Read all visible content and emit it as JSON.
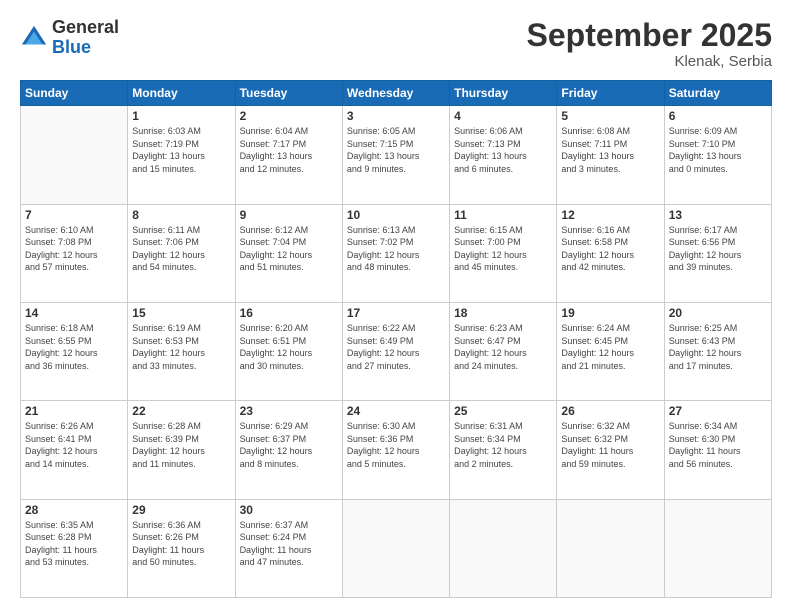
{
  "header": {
    "logo_general": "General",
    "logo_blue": "Blue",
    "month_title": "September 2025",
    "location": "Klenak, Serbia"
  },
  "days_of_week": [
    "Sunday",
    "Monday",
    "Tuesday",
    "Wednesday",
    "Thursday",
    "Friday",
    "Saturday"
  ],
  "weeks": [
    [
      {
        "day": "",
        "info": ""
      },
      {
        "day": "1",
        "info": "Sunrise: 6:03 AM\nSunset: 7:19 PM\nDaylight: 13 hours\nand 15 minutes."
      },
      {
        "day": "2",
        "info": "Sunrise: 6:04 AM\nSunset: 7:17 PM\nDaylight: 13 hours\nand 12 minutes."
      },
      {
        "day": "3",
        "info": "Sunrise: 6:05 AM\nSunset: 7:15 PM\nDaylight: 13 hours\nand 9 minutes."
      },
      {
        "day": "4",
        "info": "Sunrise: 6:06 AM\nSunset: 7:13 PM\nDaylight: 13 hours\nand 6 minutes."
      },
      {
        "day": "5",
        "info": "Sunrise: 6:08 AM\nSunset: 7:11 PM\nDaylight: 13 hours\nand 3 minutes."
      },
      {
        "day": "6",
        "info": "Sunrise: 6:09 AM\nSunset: 7:10 PM\nDaylight: 13 hours\nand 0 minutes."
      }
    ],
    [
      {
        "day": "7",
        "info": "Sunrise: 6:10 AM\nSunset: 7:08 PM\nDaylight: 12 hours\nand 57 minutes."
      },
      {
        "day": "8",
        "info": "Sunrise: 6:11 AM\nSunset: 7:06 PM\nDaylight: 12 hours\nand 54 minutes."
      },
      {
        "day": "9",
        "info": "Sunrise: 6:12 AM\nSunset: 7:04 PM\nDaylight: 12 hours\nand 51 minutes."
      },
      {
        "day": "10",
        "info": "Sunrise: 6:13 AM\nSunset: 7:02 PM\nDaylight: 12 hours\nand 48 minutes."
      },
      {
        "day": "11",
        "info": "Sunrise: 6:15 AM\nSunset: 7:00 PM\nDaylight: 12 hours\nand 45 minutes."
      },
      {
        "day": "12",
        "info": "Sunrise: 6:16 AM\nSunset: 6:58 PM\nDaylight: 12 hours\nand 42 minutes."
      },
      {
        "day": "13",
        "info": "Sunrise: 6:17 AM\nSunset: 6:56 PM\nDaylight: 12 hours\nand 39 minutes."
      }
    ],
    [
      {
        "day": "14",
        "info": "Sunrise: 6:18 AM\nSunset: 6:55 PM\nDaylight: 12 hours\nand 36 minutes."
      },
      {
        "day": "15",
        "info": "Sunrise: 6:19 AM\nSunset: 6:53 PM\nDaylight: 12 hours\nand 33 minutes."
      },
      {
        "day": "16",
        "info": "Sunrise: 6:20 AM\nSunset: 6:51 PM\nDaylight: 12 hours\nand 30 minutes."
      },
      {
        "day": "17",
        "info": "Sunrise: 6:22 AM\nSunset: 6:49 PM\nDaylight: 12 hours\nand 27 minutes."
      },
      {
        "day": "18",
        "info": "Sunrise: 6:23 AM\nSunset: 6:47 PM\nDaylight: 12 hours\nand 24 minutes."
      },
      {
        "day": "19",
        "info": "Sunrise: 6:24 AM\nSunset: 6:45 PM\nDaylight: 12 hours\nand 21 minutes."
      },
      {
        "day": "20",
        "info": "Sunrise: 6:25 AM\nSunset: 6:43 PM\nDaylight: 12 hours\nand 17 minutes."
      }
    ],
    [
      {
        "day": "21",
        "info": "Sunrise: 6:26 AM\nSunset: 6:41 PM\nDaylight: 12 hours\nand 14 minutes."
      },
      {
        "day": "22",
        "info": "Sunrise: 6:28 AM\nSunset: 6:39 PM\nDaylight: 12 hours\nand 11 minutes."
      },
      {
        "day": "23",
        "info": "Sunrise: 6:29 AM\nSunset: 6:37 PM\nDaylight: 12 hours\nand 8 minutes."
      },
      {
        "day": "24",
        "info": "Sunrise: 6:30 AM\nSunset: 6:36 PM\nDaylight: 12 hours\nand 5 minutes."
      },
      {
        "day": "25",
        "info": "Sunrise: 6:31 AM\nSunset: 6:34 PM\nDaylight: 12 hours\nand 2 minutes."
      },
      {
        "day": "26",
        "info": "Sunrise: 6:32 AM\nSunset: 6:32 PM\nDaylight: 11 hours\nand 59 minutes."
      },
      {
        "day": "27",
        "info": "Sunrise: 6:34 AM\nSunset: 6:30 PM\nDaylight: 11 hours\nand 56 minutes."
      }
    ],
    [
      {
        "day": "28",
        "info": "Sunrise: 6:35 AM\nSunset: 6:28 PM\nDaylight: 11 hours\nand 53 minutes."
      },
      {
        "day": "29",
        "info": "Sunrise: 6:36 AM\nSunset: 6:26 PM\nDaylight: 11 hours\nand 50 minutes."
      },
      {
        "day": "30",
        "info": "Sunrise: 6:37 AM\nSunset: 6:24 PM\nDaylight: 11 hours\nand 47 minutes."
      },
      {
        "day": "",
        "info": ""
      },
      {
        "day": "",
        "info": ""
      },
      {
        "day": "",
        "info": ""
      },
      {
        "day": "",
        "info": ""
      }
    ]
  ]
}
